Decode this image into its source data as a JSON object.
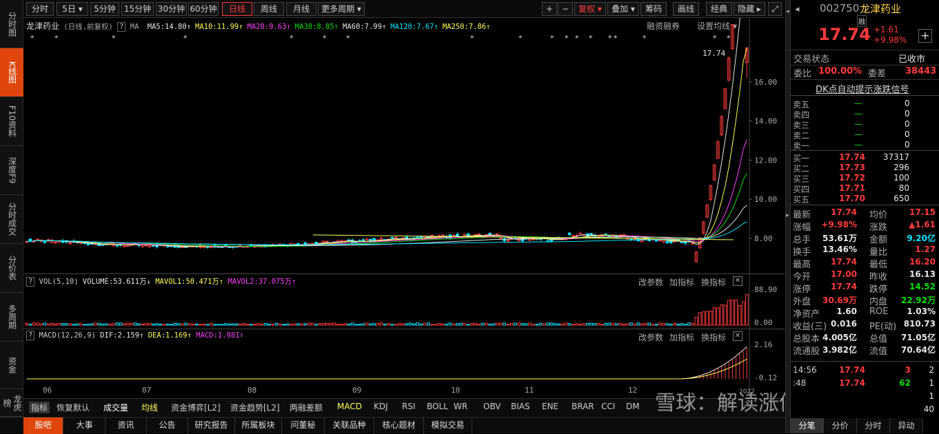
{
  "left_tabs": [
    {
      "label": "分时图",
      "active": false
    },
    {
      "label": "K线图",
      "active": true
    },
    {
      "label": "F10资料",
      "active": false
    },
    {
      "label": "深度F9",
      "active": false
    },
    {
      "label": "分时成交",
      "active": false
    },
    {
      "label": "分价表",
      "active": false
    },
    {
      "label": "多周期",
      "active": false
    },
    {
      "label": "资金",
      "active": false
    },
    {
      "label": "龙虎榜",
      "active": false
    }
  ],
  "toolbar": {
    "periods": [
      {
        "label": "分时",
        "active": false
      },
      {
        "label": "5日 ▾",
        "active": false
      },
      {
        "label": "5分钟",
        "active": false
      },
      {
        "label": "15分钟",
        "active": false
      },
      {
        "label": "30分钟",
        "active": false
      },
      {
        "label": "60分钟",
        "active": false
      },
      {
        "label": "日线",
        "active": true
      },
      {
        "label": "周线",
        "active": false
      },
      {
        "label": "月线",
        "active": false
      },
      {
        "label": "更多周期 ▾",
        "active": false
      }
    ],
    "plus": "+",
    "minus": "−",
    "fuquan": "复权 ▾",
    "diejia": "叠加 ▾",
    "chouma": "筹码",
    "huaxian": "画线",
    "jingdian": "经典",
    "yincang": "隐藏 ▸",
    "fullscreen": "⤢"
  },
  "main": {
    "stock_name": "龙津药业",
    "mode": "(日线,前复权)",
    "help": "?",
    "ma_label": "MA",
    "ma": [
      {
        "text": "MA5:14.80",
        "arrow": "↑",
        "color": "#e8e8e8"
      },
      {
        "text": "MA10:11.99",
        "arrow": "↑",
        "color": "#ffff55"
      },
      {
        "text": "MA20:9.63",
        "arrow": "↑",
        "color": "#ff40ff"
      },
      {
        "text": "MA30:8.85",
        "arrow": "↑",
        "color": "#00e000"
      },
      {
        "text": "MA60:7.99",
        "arrow": "↑",
        "color": "#e8e8e8"
      },
      {
        "text": "MA120:7.67",
        "arrow": "↑",
        "color": "#00e5ff"
      },
      {
        "text": "MA250:7.86",
        "arrow": "↑",
        "color": "#ffff55"
      }
    ],
    "rzrq": "融资融券",
    "set_ma": "设置均线 ▾",
    "last_price_tag": "17.74",
    "price_labels": [
      "16.00",
      "14.00",
      "12.00",
      "10.00",
      "8.00"
    ],
    "x_labels": [
      "06",
      "07",
      "08",
      "09",
      "10",
      "11",
      "12"
    ]
  },
  "vol": {
    "help": "?",
    "title": "VOL(5,10)",
    "volume": "VOLUME:53.611万",
    "volume_arrow": "↓",
    "mavol1": "MAVOL1:50.471万",
    "mavol1_arrow": "↑",
    "mavol2": "MAVOL2:37.075万",
    "mavol2_arrow": "↑",
    "btn_params": "改参数",
    "btn_add": "加指标",
    "btn_switch": "换指标",
    "close": "✕",
    "axis": [
      "88.90",
      "0.00"
    ],
    "colors": {
      "up": "#ff3b3b",
      "down": "#00e5ff"
    }
  },
  "macd": {
    "help": "?",
    "title": "MACD(12,26,9)",
    "dif": "DIF:2.159",
    "dif_arrow": "↑",
    "dea": "DEA:1.169",
    "dea_arrow": "↑",
    "macd": "MACD:1.981",
    "macd_arrow": "↑",
    "btn_params": "改参数",
    "btn_add": "加指标",
    "btn_switch": "换指标",
    "close": "✕",
    "axis": [
      "2.16",
      "-0.12"
    ],
    "year_label": "2022"
  },
  "bottom_tabs": [
    {
      "label": "指标",
      "active": true
    },
    {
      "label": "恢复默认",
      "active": false
    },
    {
      "label": "成交量",
      "active": false
    },
    {
      "label": "均线",
      "active": false
    },
    {
      "label": "资金博弈[L2]",
      "active": false
    },
    {
      "label": "资金趋势[L2]",
      "active": false
    },
    {
      "label": "两融差额",
      "active": false
    },
    {
      "label": "MACD",
      "active": false
    },
    {
      "label": "KDJ",
      "active": false
    },
    {
      "label": "RSI",
      "active": false
    },
    {
      "label": "BOLL",
      "active": false
    },
    {
      "label": "WR",
      "active": false
    },
    {
      "label": "OBV",
      "active": false
    },
    {
      "label": "BIAS",
      "active": false
    },
    {
      "label": "ENE",
      "active": false
    },
    {
      "label": "BRAR",
      "active": false
    },
    {
      "label": "CCI",
      "active": false
    },
    {
      "label": "DM",
      "active": false
    }
  ],
  "footer": [
    {
      "label": "股吧",
      "active": true
    },
    {
      "label": "大事",
      "active": false
    },
    {
      "label": "资讯",
      "active": false
    },
    {
      "label": "公告",
      "active": false
    },
    {
      "label": "研究报告",
      "active": false
    },
    {
      "label": "所属板块",
      "active": false
    },
    {
      "label": "问董秘",
      "active": false
    },
    {
      "label": "关联品种",
      "active": false
    },
    {
      "label": "核心题材",
      "active": false
    },
    {
      "label": "模拟交易",
      "active": false
    }
  ],
  "watermark": "雪球：解读涨停板",
  "quote": {
    "code": "002750",
    "name": "龙津药业",
    "rong": "融",
    "price": "17.74",
    "change": "+1.61",
    "change_pct": "+9.98%",
    "add_btn": "+",
    "status_label": "交易状态",
    "status_value": "已收市",
    "weibi_label": "委比",
    "weibi": "100.00%",
    "weicha_label": "委差",
    "weicha": "38443",
    "dk_link": "DK点自动提示涨跌信号",
    "asks": [
      {
        "label": "卖五",
        "price": "—",
        "vol": "0"
      },
      {
        "label": "卖四",
        "price": "—",
        "vol": "0"
      },
      {
        "label": "卖三",
        "price": "—",
        "vol": "0"
      },
      {
        "label": "卖二",
        "price": "—",
        "vol": "0"
      },
      {
        "label": "卖一",
        "price": "—",
        "vol": "0"
      }
    ],
    "bids": [
      {
        "label": "买一",
        "price": "17.74",
        "vol": "37317"
      },
      {
        "label": "买二",
        "price": "17.73",
        "vol": "296"
      },
      {
        "label": "买三",
        "price": "17.72",
        "vol": "100"
      },
      {
        "label": "买四",
        "price": "17.71",
        "vol": "80"
      },
      {
        "label": "买五",
        "price": "17.70",
        "vol": "650"
      }
    ],
    "stats": [
      {
        "l1": "最新",
        "v1": "17.74",
        "c1": "red",
        "l2": "均价",
        "v2": "17.15",
        "c2": "red"
      },
      {
        "l1": "涨幅",
        "v1": "+9.98%",
        "c1": "red",
        "l2": "涨跌",
        "v2": "▲1.61",
        "c2": "red"
      },
      {
        "l1": "总手",
        "v1": "53.61万",
        "c1": "wht",
        "l2": "金额",
        "v2": "9.20亿",
        "c2": "cyn"
      },
      {
        "l1": "换手",
        "v1": "13.46%",
        "c1": "wht",
        "l2": "量比",
        "v2": "1.27",
        "c2": "red"
      },
      {
        "l1": "最高",
        "v1": "17.74",
        "c1": "red",
        "l2": "最低",
        "v2": "16.20",
        "c2": "red"
      },
      {
        "l1": "今开",
        "v1": "17.00",
        "c1": "red",
        "l2": "昨收",
        "v2": "16.13",
        "c2": "wht"
      },
      {
        "l1": "涨停",
        "v1": "17.74",
        "c1": "red",
        "l2": "跌停",
        "v2": "14.52",
        "c2": "grn"
      },
      {
        "l1": "外盘",
        "v1": "30.69万",
        "c1": "red",
        "l2": "内盘",
        "v2": "22.92万",
        "c2": "grn"
      },
      {
        "l1": "净资产",
        "v1": "1.60",
        "c1": "wht",
        "l2": "ROE",
        "v2": "1.03%",
        "c2": "wht"
      },
      {
        "l1": "收益(三)",
        "v1": "0.016",
        "c1": "wht",
        "l2": "PE(动)",
        "v2": "810.73",
        "c2": "wht"
      },
      {
        "l1": "总股本",
        "v1": "4.005亿",
        "c1": "wht",
        "l2": "总值",
        "v2": "71.05亿",
        "c2": "wht"
      },
      {
        "l1": "流通股",
        "v1": "3.982亿",
        "c1": "wht",
        "l2": "流值",
        "v2": "70.64亿",
        "c2": "wht"
      }
    ],
    "ticks": [
      {
        "time": "14:56",
        "price": "17.74",
        "vol": "3",
        "num": "2",
        "vc": "red"
      },
      {
        "time": ":48",
        "price": "17.74",
        "vol": "62",
        "num": "1",
        "vc": "grn"
      },
      {
        "time": "",
        "price": "",
        "vol": "",
        "num": "1",
        "vc": "grn"
      },
      {
        "time": "",
        "price": "",
        "vol": "",
        "num": "40",
        "vc": "wht"
      }
    ],
    "tabs": [
      {
        "label": "分笔",
        "active": true
      },
      {
        "label": "分价",
        "active": false
      },
      {
        "label": "分时",
        "active": false
      },
      {
        "label": "异动",
        "active": false
      }
    ]
  }
}
